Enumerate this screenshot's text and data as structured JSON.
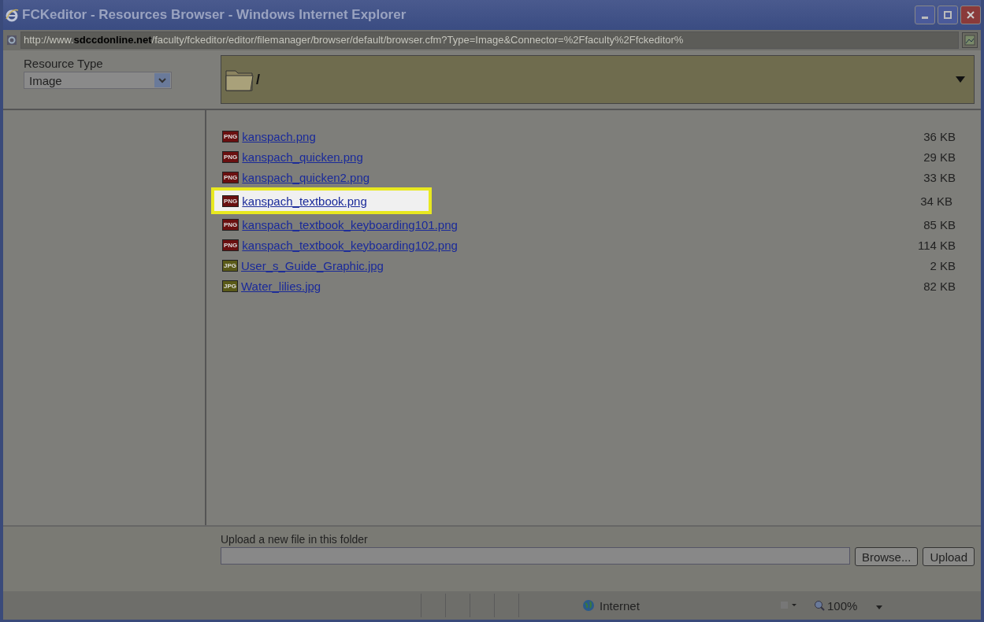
{
  "window": {
    "title": "FCKeditor - Resources Browser - Windows Internet Explorer"
  },
  "address_bar": {
    "prefix": "http://www.",
    "domain": "sdccdonline.net",
    "path": "/faculty/fckeditor/editor/filemanager/browser/default/browser.cfm?Type=Image&Connector=%2Ffaculty%2Ffckeditor%"
  },
  "resource_type": {
    "label": "Resource Type",
    "value": "Image"
  },
  "folder": {
    "path": "/"
  },
  "files": [
    {
      "name": "kanspach.png",
      "size": "36 KB",
      "type": "PNG",
      "selected": false
    },
    {
      "name": "kanspach_quicken.png",
      "size": "29 KB",
      "type": "PNG",
      "selected": false
    },
    {
      "name": "kanspach_quicken2.png",
      "size": "33 KB",
      "type": "PNG",
      "selected": false
    },
    {
      "name": "kanspach_textbook.png",
      "size": "34 KB",
      "type": "PNG",
      "selected": true
    },
    {
      "name": "kanspach_textbook_keyboarding101.png",
      "size": "85 KB",
      "type": "PNG",
      "selected": false
    },
    {
      "name": "kanspach_textbook_keyboarding102.png",
      "size": "114 KB",
      "type": "PNG",
      "selected": false
    },
    {
      "name": "User_s_Guide_Graphic.jpg",
      "size": "2 KB",
      "type": "JPG",
      "selected": false
    },
    {
      "name": "Water_lilies.jpg",
      "size": "82 KB",
      "type": "JPG",
      "selected": false
    }
  ],
  "upload": {
    "label": "Upload a new file in this folder",
    "browse": "Browse...",
    "upload": "Upload"
  },
  "status_bar": {
    "zone": "Internet",
    "zoom": "100%"
  }
}
